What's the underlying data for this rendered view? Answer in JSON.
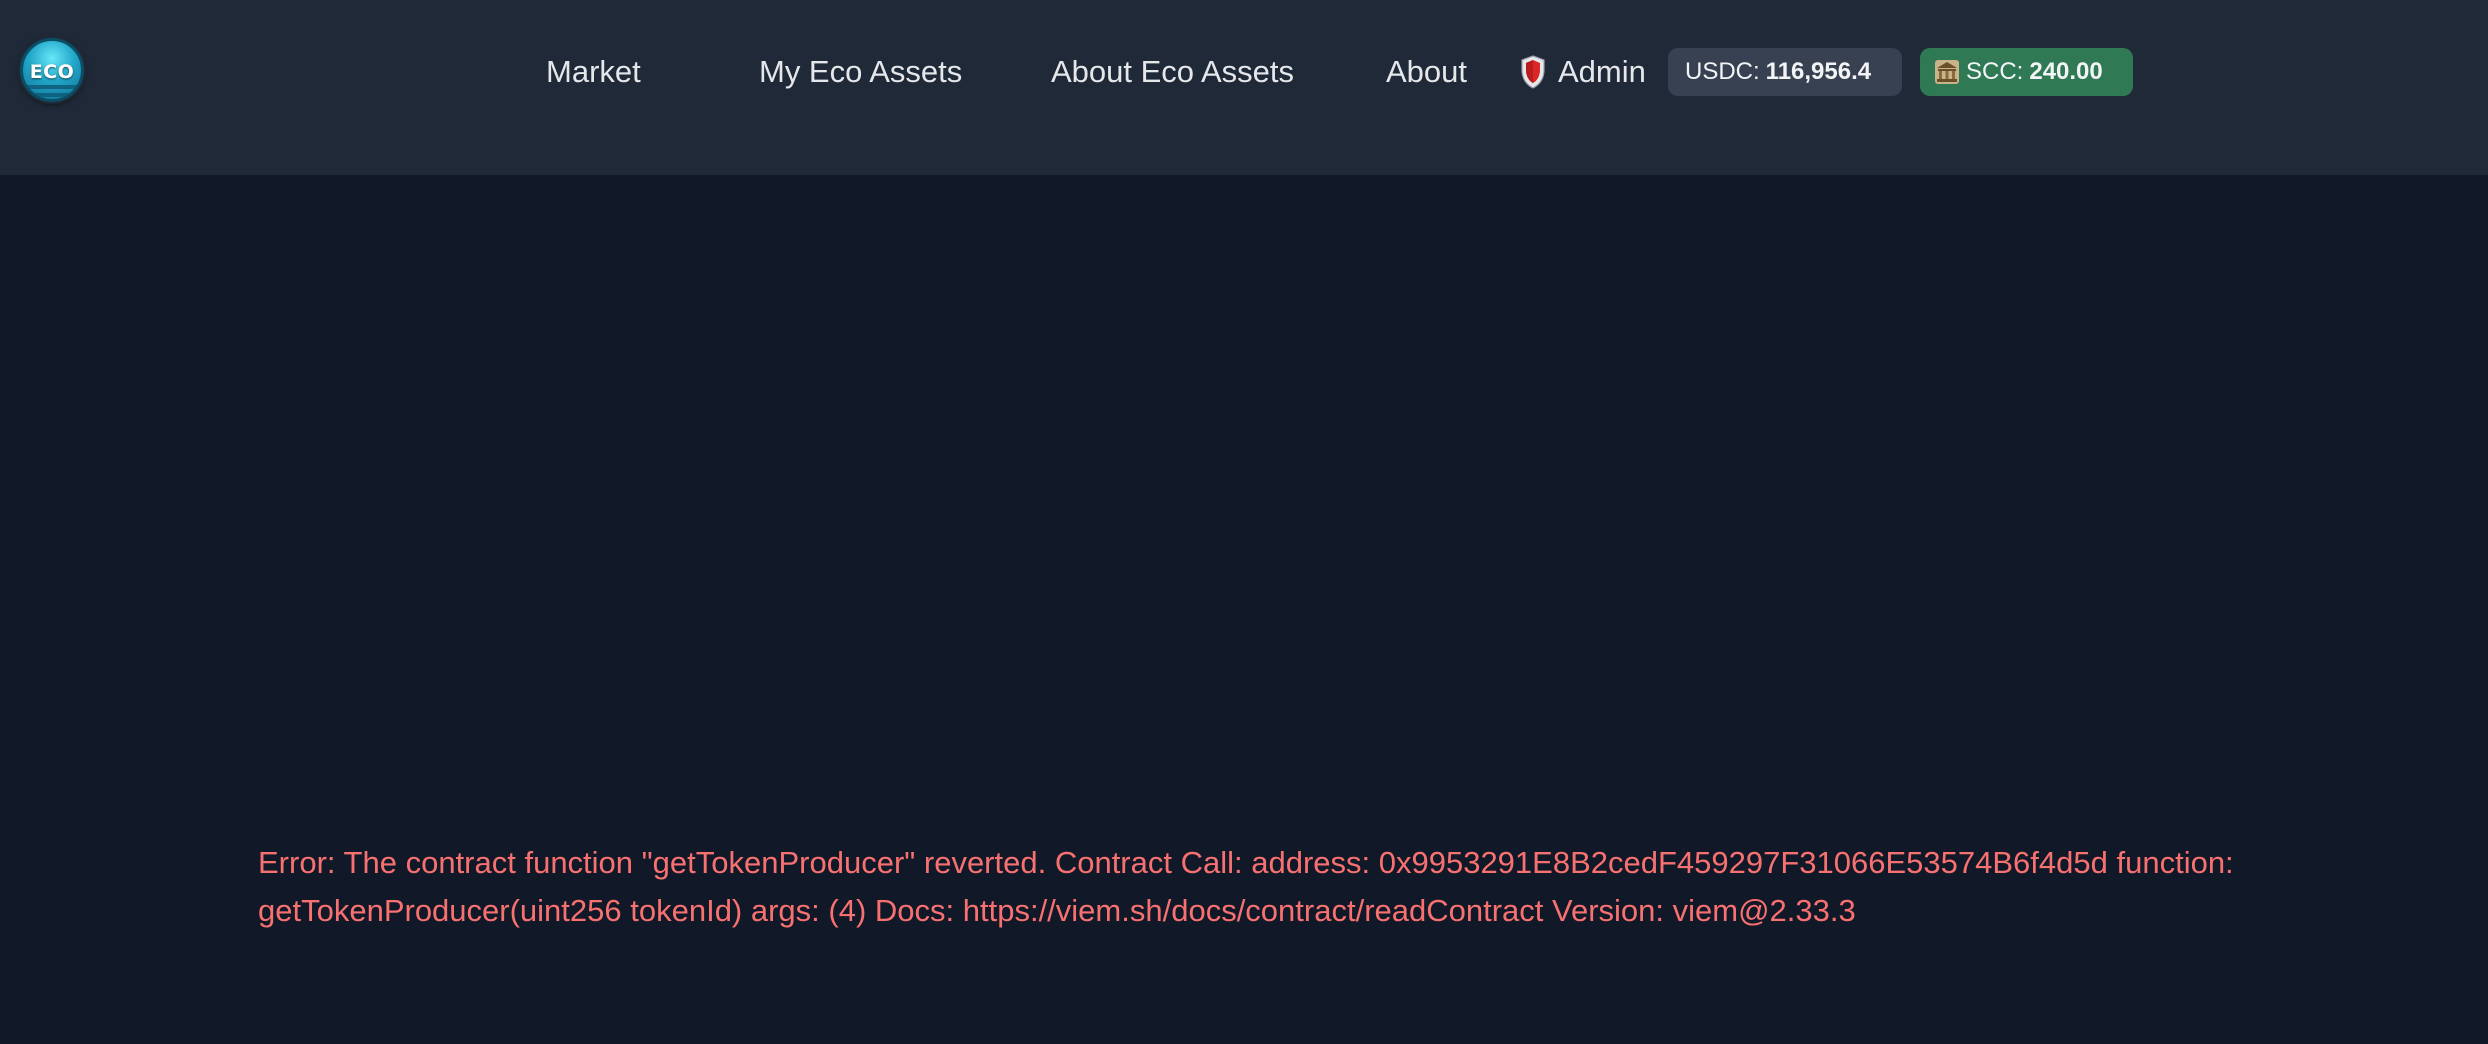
{
  "header": {
    "logo_text": "ECO",
    "nav": [
      {
        "label": "Market"
      },
      {
        "label": "My Eco Assets"
      },
      {
        "label": "About Eco Assets"
      },
      {
        "label": "About"
      }
    ],
    "admin": {
      "label": "Admin",
      "icon": "shield-icon"
    },
    "balances": {
      "usdc": {
        "label": "USDC:",
        "value": "116,956.4",
        "bg_color": "#374151"
      },
      "scc": {
        "label": "SCC:",
        "value": "240.00",
        "icon": "bank-icon",
        "bg_color": "#2f7a55"
      }
    }
  },
  "main": {
    "error_message": "Error: The contract function \"getTokenProducer\" reverted. Contract Call: address: 0x9953291E8B2cedF459297F31066E53574B6f4d5d function: getTokenProducer(uint256 tokenId) args: (4) Docs: https://viem.sh/docs/contract/readContract Version: viem@2.33.3",
    "error_color": "#f87171"
  },
  "colors": {
    "page_bg": "#111827",
    "header_bg": "#1f2937",
    "text": "#e5e7eb"
  }
}
